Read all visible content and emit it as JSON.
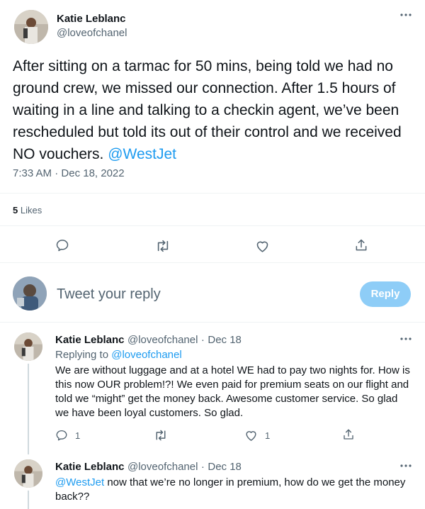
{
  "main_tweet": {
    "author_name": "Katie Leblanc",
    "author_handle": "@loveofchanel",
    "text": "After sitting on a tarmac for 50 mins, being told we had no ground crew, we missed our connection. After 1.5 hours of waiting in a line and talking to a checkin agent, we’ve been rescheduled but told its out of their control and we received NO vouchers.",
    "mention": "@WestJet",
    "time": "7:33 AM",
    "dot": "·",
    "date": "Dec 18, 2022",
    "likes_count": "5",
    "likes_label": "Likes"
  },
  "composer": {
    "placeholder": "Tweet your reply",
    "reply_button": "Reply"
  },
  "replies": [
    {
      "author_name": "Katie Leblanc",
      "author_handle": "@loveofchanel",
      "dot": "·",
      "date": "Dec 18",
      "replying_to_label": "Replying to",
      "replying_to_handle": "@loveofchanel",
      "text": "We are without luggage and at a hotel WE had to pay two nights for.  How is this now OUR problem!?! We even paid for premium seats on our flight and told we “might” get the money back. Awesome customer service. So glad we have been loyal customers. So glad.",
      "reply_count": "1",
      "like_count": "1"
    },
    {
      "author_name": "Katie Leblanc",
      "author_handle": "@loveofchanel",
      "dot": "·",
      "date": "Dec 18",
      "mention": "@WestJet",
      "text": "now that we’re no longer in premium, how do we get the money back??"
    }
  ],
  "icons": {
    "more": "more-icon",
    "reply": "reply-icon",
    "retweet": "retweet-icon",
    "like": "heart-icon",
    "share": "share-icon"
  },
  "colors": {
    "link": "#1d9bf0",
    "reply_button_bg": "#8ecdf7",
    "secondary_text": "#536471"
  }
}
